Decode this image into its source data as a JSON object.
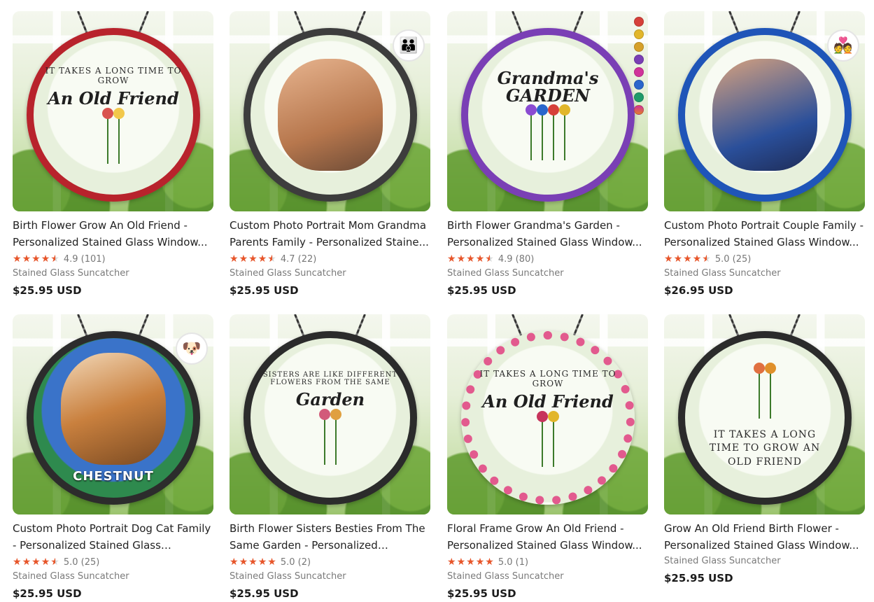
{
  "products": [
    {
      "title": "Birth Flower Grow An Old Friend - Personalized Stained Glass Window...",
      "rating": "4.9",
      "reviews": "(101)",
      "stars": "4.5",
      "category": "Stained Glass Suncatcher",
      "price": "$25.95 USD",
      "art_arc": "It takes a long time to grow",
      "art_big": "An Old Friend",
      "rim": "#b8232c",
      "flower": "#d9534f"
    },
    {
      "title": "Custom Photo Portrait Mom Grandma Parents Family - Personalized Staine...",
      "rating": "4.7",
      "reviews": "(22)",
      "stars": "4.5",
      "category": "Stained Glass Suncatcher",
      "price": "$25.95 USD",
      "art_arc": "",
      "art_big": "",
      "rim": "#3d3d3d",
      "flower": "#e0a040"
    },
    {
      "title": "Birth Flower Grandma's Garden - Personalized Stained Glass Window...",
      "rating": "4.9",
      "reviews": "(80)",
      "stars": "4.5",
      "category": "Stained Glass Suncatcher",
      "price": "$25.95 USD",
      "art_arc": "",
      "art_big": "Grandma's GARDEN",
      "rim": "#7a3fb5",
      "flower": "#8a4bd1"
    },
    {
      "title": "Custom Photo Portrait Couple Family - Personalized Stained Glass Window...",
      "rating": "5.0",
      "reviews": "(25)",
      "stars": "4.5",
      "category": "Stained Glass Suncatcher",
      "price": "$26.95 USD",
      "art_arc": "",
      "art_big": "",
      "rim": "#1f55b8",
      "flower": "#2a66cc"
    },
    {
      "title": "Custom Photo Portrait Dog Cat Family - Personalized Stained Glass Window...",
      "rating": "5.0",
      "reviews": "(25)",
      "stars": "4.5",
      "category": "Stained Glass Suncatcher",
      "price": "$25.95 USD",
      "art_arc": "",
      "art_big": "",
      "label": "CHESTNUT",
      "rim": "#2c2c2c",
      "flower": "#c9803e"
    },
    {
      "title": "Birth Flower Sisters Besties From The Same Garden - Personalized Stained...",
      "rating": "5.0",
      "reviews": "(2)",
      "stars": "5",
      "category": "Stained Glass Suncatcher",
      "price": "$25.95 USD",
      "art_arc": "Sisters are like different flowers from the same",
      "art_big": "Garden",
      "rim": "#2b2b2b",
      "flower": "#d25a7a"
    },
    {
      "title": "Floral Frame Grow An Old Friend - Personalized Stained Glass Window...",
      "rating": "5.0",
      "reviews": "(1)",
      "stars": "5",
      "category": "Stained Glass Suncatcher",
      "price": "$25.95 USD",
      "art_arc": "It takes a long time to grow",
      "art_big": "An Old Friend",
      "rim": "#e25a8e",
      "flower": "#c7345c"
    },
    {
      "title": "Grow An Old Friend Birth Flower - Personalized Stained Glass Window...",
      "rating": "",
      "reviews": "",
      "stars": "",
      "category": "Stained Glass Suncatcher",
      "price": "$25.95 USD",
      "art_arc": "",
      "art_big": "It takes a long time to grow an old friend",
      "rim": "#2b2b2b",
      "flower": "#e07040"
    }
  ],
  "palette": [
    "#d6403a",
    "#e2b62a",
    "#7a3fb5",
    "#d0339a",
    "#2a66cc",
    "#1f9a6a",
    "#e07d2c"
  ]
}
